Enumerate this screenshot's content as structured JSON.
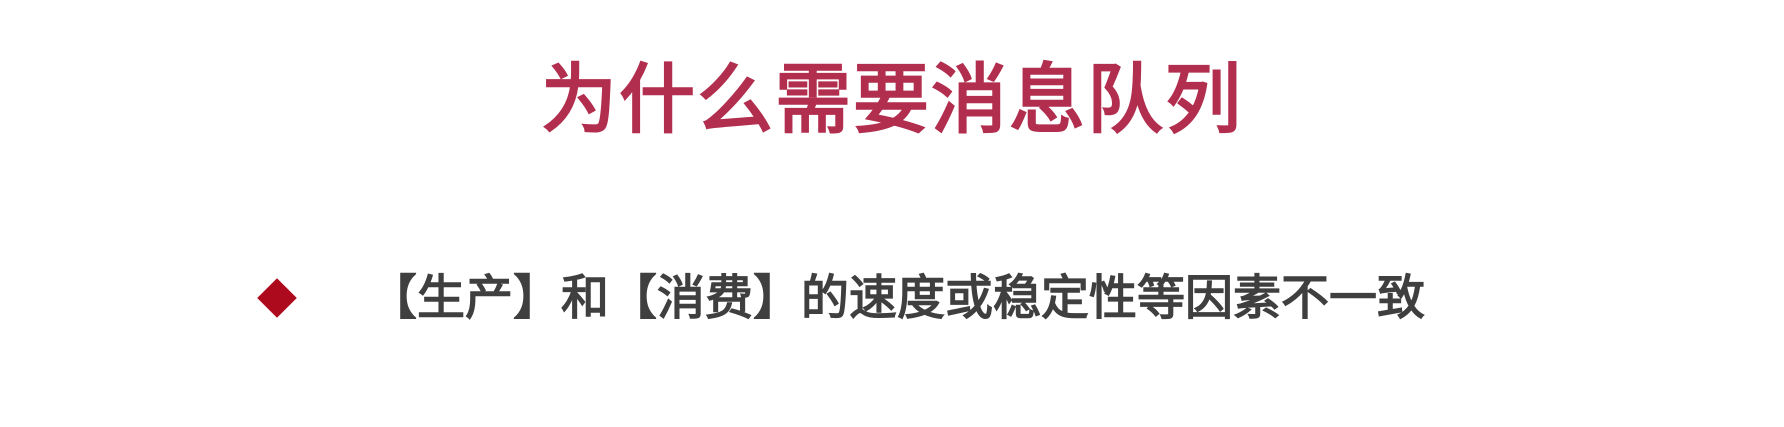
{
  "slide": {
    "title": "为什么需要消息队列",
    "bullets": [
      {
        "text": "【生产】和【消费】的速度或稳定性等因素不一致"
      }
    ]
  },
  "colors": {
    "title": "#b22e4e",
    "bullet_marker": "#ad0a1e",
    "body_text": "#3f3f3f",
    "background": "#ffffff"
  },
  "icons": {
    "bullet_marker": "diamond-bullet-icon"
  }
}
